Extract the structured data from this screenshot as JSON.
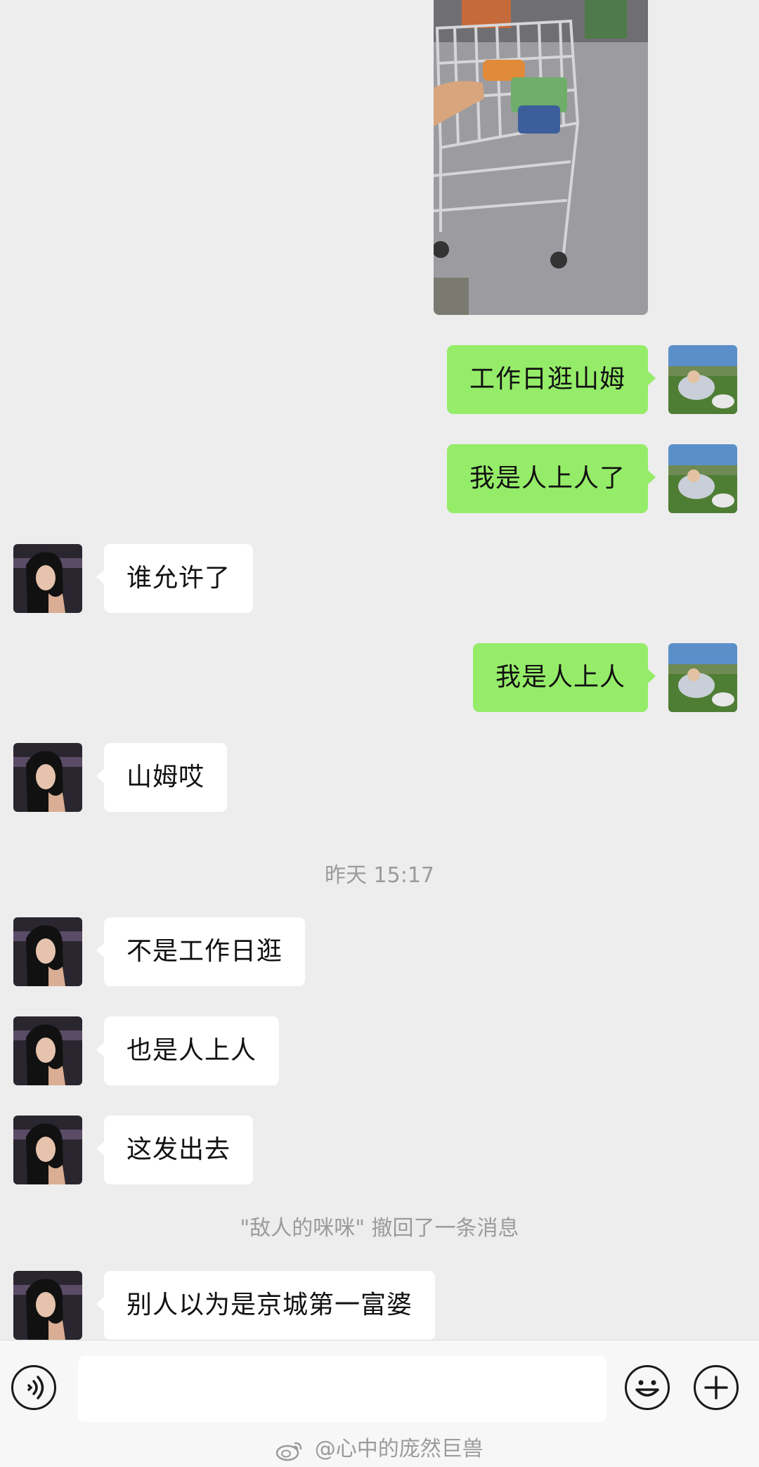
{
  "messages": {
    "m1": "工作日逛山姆",
    "m2": "我是人上人了",
    "m3": "谁允许了",
    "m4": "我是人上人",
    "m5": "山姆哎",
    "m6": "不是工作日逛",
    "m7": "也是人上人",
    "m8": "这发出去",
    "m9": "别人以为是京城第一富婆"
  },
  "system": {
    "timestamp": "昨天 15:17",
    "recall_notice": "\"敌人的咪咪\" 撤回了一条消息"
  },
  "input": {
    "placeholder": ""
  },
  "icons": {
    "voice": "voice-icon",
    "emoji": "emoji-icon",
    "plus": "plus-icon"
  },
  "watermark": {
    "text": "@心中的庞然巨兽"
  },
  "colors": {
    "background": "#ededed",
    "outgoing_bubble": "#95ec69",
    "incoming_bubble": "#ffffff",
    "system_text": "#9b9b9b"
  }
}
